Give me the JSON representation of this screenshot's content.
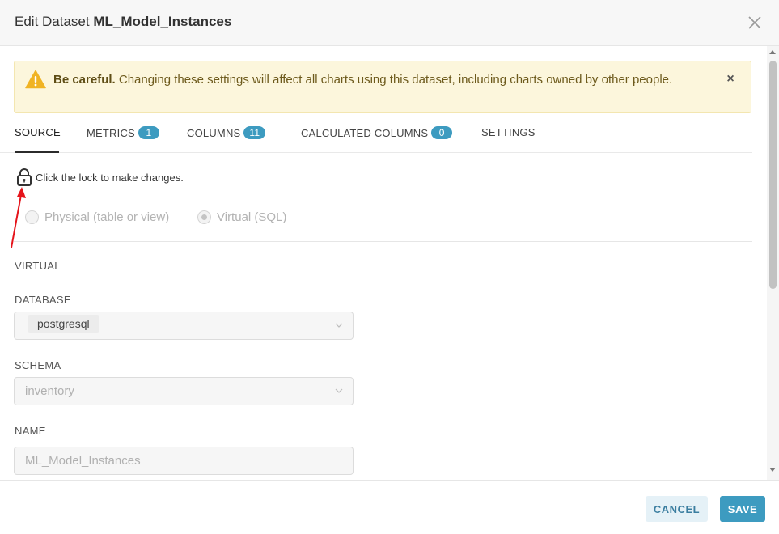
{
  "header": {
    "title_prefix": "Edit Dataset",
    "dataset_name": "ML_Model_Instances"
  },
  "alert": {
    "bold": "Be careful.",
    "message": " Changing these settings will affect all charts using this dataset, including charts owned by other people.",
    "close_symbol": "×"
  },
  "tabs": [
    {
      "label": "SOURCE",
      "badge": null,
      "active": true
    },
    {
      "label": "METRICS",
      "badge": "1",
      "active": false
    },
    {
      "label": "COLUMNS",
      "badge": "11",
      "active": false
    },
    {
      "label": "CALCULATED COLUMNS",
      "badge": "0",
      "active": false
    },
    {
      "label": "SETTINGS",
      "badge": null,
      "active": false
    }
  ],
  "lock": {
    "text": "Click the lock to make changes."
  },
  "dataset_type": {
    "options": [
      {
        "label": "Physical (table or view)",
        "checked": false
      },
      {
        "label": "Virtual (SQL)",
        "checked": true
      }
    ]
  },
  "form": {
    "section_title": "VIRTUAL",
    "database": {
      "label": "DATABASE",
      "value": "postgresql"
    },
    "schema": {
      "label": "SCHEMA",
      "value": "inventory"
    },
    "name": {
      "label": "NAME",
      "value": "ML_Model_Instances"
    }
  },
  "footer": {
    "cancel_label": "CANCEL",
    "save_label": "SAVE"
  },
  "colors": {
    "accent": "#3d9bc0",
    "alert_bg": "#fcf6dc",
    "warning_icon": "#f0b323",
    "annotation_arrow": "#e5141b"
  },
  "icons": {
    "close": "close-icon",
    "warning": "warning-icon",
    "lock": "lock-icon",
    "chevron": "chevron-down-icon"
  }
}
